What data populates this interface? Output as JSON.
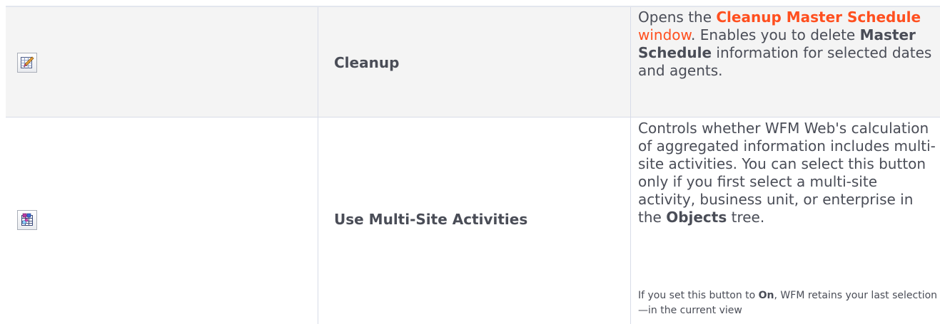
{
  "rows": [
    {
      "icon": "cleanup-icon",
      "name": "Cleanup",
      "desc_prefix": "Opens the ",
      "link_bold": "Cleanup Master Schedule",
      "link_tail": " window",
      "desc_mid": ". Enables you to delete ",
      "desc_bold": "Master Schedule",
      "desc_suffix": " information for selected dates and agents."
    },
    {
      "icon": "multi-site-activities-icon",
      "name": "Use Multi-Site Activities",
      "desc_prefix": "Controls whether WFM Web's calculation of aggregated information includes multi-site activities. You can select this button only if you first select a multi-site activity, business unit, or enterprise in the ",
      "desc_bold": "Objects",
      "desc_suffix": " tree.",
      "note_prefix": "If you set this button to ",
      "note_bold": "On",
      "note_suffix": ", WFM retains your last selection—in the current view"
    }
  ]
}
